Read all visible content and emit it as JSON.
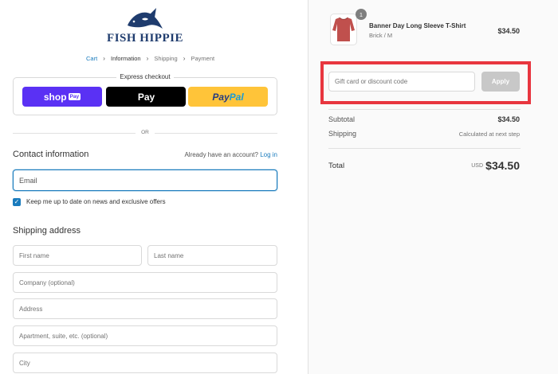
{
  "brand": {
    "logo_text": "FISH HIPPIE",
    "logo_color": "#1f3c6e"
  },
  "breadcrumb": {
    "items": [
      "Cart",
      "Information",
      "Shipping",
      "Payment"
    ],
    "current_index": 1
  },
  "express_checkout": {
    "title": "Express checkout",
    "shop_pay_label": "shop",
    "shop_pay_badge": "Pay",
    "apple_pay_label": "Pay",
    "paypal_label_1": "Pay",
    "paypal_label_2": "Pal"
  },
  "divider": {
    "or_text": "OR"
  },
  "contact": {
    "title": "Contact information",
    "have_account_text": "Already have an account?",
    "login_label": "Log in",
    "email_placeholder": "Email",
    "keep_updated_label": "Keep me up to date on news and exclusive offers",
    "keep_updated_checked": true
  },
  "shipping_address": {
    "title": "Shipping address",
    "first_name_placeholder": "First name",
    "last_name_placeholder": "Last name",
    "company_placeholder": "Company (optional)",
    "address_placeholder": "Address",
    "apartment_placeholder": "Apartment, suite, etc. (optional)",
    "city_placeholder": "City"
  },
  "order_summary": {
    "product": {
      "name": "Banner Day Long Sleeve T-Shirt",
      "variant": "Brick / M",
      "price": "$34.50",
      "quantity": "1",
      "color": "#c0504d"
    },
    "discount": {
      "placeholder": "Gift card or discount code",
      "apply_label": "Apply",
      "highlight_color": "#e8363f"
    },
    "subtotal_label": "Subtotal",
    "subtotal_value": "$34.50",
    "shipping_label": "Shipping",
    "shipping_value": "Calculated at next step",
    "total_label": "Total",
    "total_currency": "USD",
    "total_value": "$34.50"
  },
  "colors": {
    "accent": "#197bbd",
    "shop_pay": "#5a31f4",
    "paypal": "#ffc439"
  }
}
